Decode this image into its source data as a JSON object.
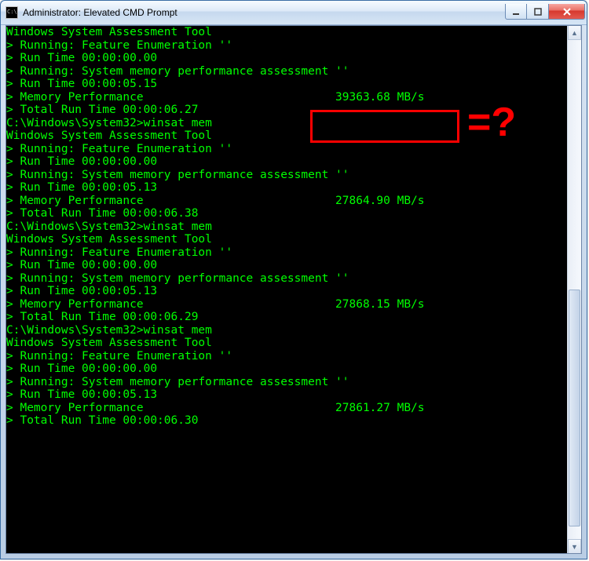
{
  "window": {
    "title": "Administrator: Elevated CMD Prompt",
    "icon_name": "cmd-icon"
  },
  "scrollbar": {
    "thumb_top_pct": 50,
    "thumb_height_pct": 47
  },
  "annotation": {
    "label": "=?"
  },
  "runs": [
    {
      "prompt": "",
      "tool": "Windows System Assessment Tool",
      "lines": [
        "> Running: Feature Enumeration ''",
        "> Run Time 00:00:00.00",
        "> Running: System memory performance assessment ''",
        "> Run Time 00:00:05.15"
      ],
      "mem_label": "> Memory Performance",
      "mem_value": "39363.68 MB/s",
      "total": "> Total Run Time 00:00:06.27"
    },
    {
      "prompt": "C:\\Windows\\System32>winsat mem",
      "tool": "Windows System Assessment Tool",
      "lines": [
        "> Running: Feature Enumeration ''",
        "> Run Time 00:00:00.00",
        "> Running: System memory performance assessment ''",
        "> Run Time 00:00:05.13"
      ],
      "mem_label": "> Memory Performance",
      "mem_value": "27864.90 MB/s",
      "total": "> Total Run Time 00:00:06.38"
    },
    {
      "prompt": "C:\\Windows\\System32>winsat mem",
      "tool": "Windows System Assessment Tool",
      "lines": [
        "> Running: Feature Enumeration ''",
        "> Run Time 00:00:00.00",
        "> Running: System memory performance assessment ''",
        "> Run Time 00:00:05.13"
      ],
      "mem_label": "> Memory Performance",
      "mem_value": "27868.15 MB/s",
      "total": "> Total Run Time 00:00:06.29"
    },
    {
      "prompt": "C:\\Windows\\System32>winsat mem",
      "tool": "Windows System Assessment Tool",
      "lines": [
        "> Running: Feature Enumeration ''",
        "> Run Time 00:00:00.00",
        "> Running: System memory performance assessment ''",
        "> Run Time 00:00:05.13"
      ],
      "mem_label": "> Memory Performance",
      "mem_value": "27861.27 MB/s",
      "total": "> Total Run Time 00:00:06.30"
    }
  ]
}
